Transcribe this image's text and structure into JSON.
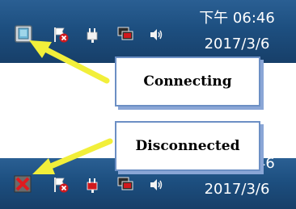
{
  "top_taskbar": {
    "clock": {
      "time": "下午 06:46",
      "date": "2017/3/6"
    },
    "network_status": "connecting",
    "icons": [
      "network-connecting-icon",
      "action-center-icon",
      "power-icon",
      "display-icon",
      "volume-icon"
    ]
  },
  "bottom_taskbar": {
    "clock": {
      "time": "下午 06:46",
      "date": "2017/3/6"
    },
    "network_status": "disconnected",
    "icons": [
      "network-disconnected-icon",
      "action-center-icon",
      "power-icon",
      "display-icon",
      "volume-icon"
    ]
  },
  "callouts": {
    "connecting": "Connecting",
    "disconnected": "Disconnected"
  },
  "colors": {
    "arrow": "#f2ef3a",
    "taskbar": "#1d4f80",
    "callout_border": "#6c8fc4",
    "error_red": "#d0191e"
  }
}
